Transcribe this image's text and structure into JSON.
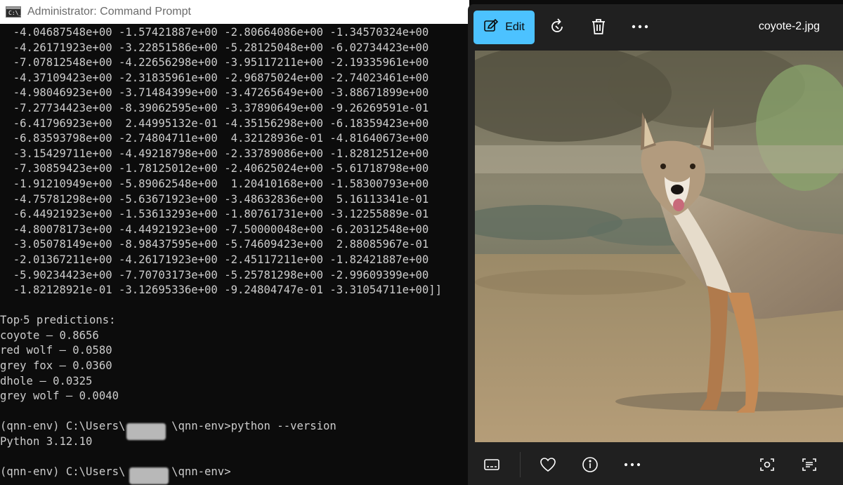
{
  "cmd": {
    "title": "Administrator: Command Prompt",
    "icon_text": "C:\\_",
    "lines": [
      "  -4.04687548e+00 -1.57421887e+00 -2.80664086e+00 -1.34570324e+00",
      "  -4.26171923e+00 -3.22851586e+00 -5.28125048e+00 -6.02734423e+00",
      "  -7.07812548e+00 -4.22656298e+00 -3.95117211e+00 -2.19335961e+00",
      "  -4.37109423e+00 -2.31835961e+00 -2.96875024e+00 -2.74023461e+00",
      "  -4.98046923e+00 -3.71484399e+00 -3.47265649e+00 -3.88671899e+00",
      "  -7.27734423e+00 -8.39062595e+00 -3.37890649e+00 -9.26269591e-01",
      "  -6.41796923e+00  2.44995132e-01 -4.35156298e+00 -6.18359423e+00",
      "  -6.83593798e+00 -2.74804711e+00  4.32128936e-01 -4.81640673e+00",
      "  -3.15429711e+00 -4.49218798e+00 -2.33789086e+00 -1.82812512e+00",
      "  -7.30859423e+00 -1.78125012e+00 -2.40625024e+00 -5.61718798e+00",
      "  -1.91210949e+00 -5.89062548e+00  1.20410168e+00 -1.58300793e+00",
      "  -4.75781298e+00 -5.63671923e+00 -3.48632836e+00  5.16113341e-01",
      "  -6.44921923e+00 -1.53613293e+00 -1.80761731e+00 -3.12255889e-01",
      "  -4.80078173e+00 -4.44921923e+00 -7.50000048e+00 -6.20312548e+00",
      "  -3.05078149e+00 -8.98437595e+00 -5.74609423e+00  2.88085967e-01",
      "  -2.01367211e+00 -4.26171923e+00 -2.45117211e+00 -1.82421887e+00",
      "  -5.90234423e+00 -7.70703173e+00 -5.25781298e+00 -2.99609399e+00",
      "  -1.82128921e-01 -3.12695336e+00 -9.24804747e-01 -3.31054711e+00]]",
      "",
      "Top‧5 predictions:",
      "coyote — 0.8656",
      "red wolf — 0.0580",
      "grey fox — 0.0360",
      "dhole — 0.0325",
      "grey wolf — 0.0040",
      "",
      "(qnn-env) C:\\Users\\       \\qnn-env>python --version",
      "Python 3.12.10",
      "",
      "(qnn-env) C:\\Users\\       \\qnn-env>"
    ]
  },
  "photos": {
    "edit_label": "Edit",
    "filename": "coyote-2.jpg",
    "toolbar_icons": [
      "edit-icon",
      "rotate-icon",
      "delete-icon",
      "more-icon"
    ],
    "bottom_icons": [
      "filmstrip-icon",
      "heart-icon",
      "info-icon",
      "more-icon",
      "visual-search-icon",
      "text-recognition-icon"
    ],
    "accent_color": "#4cc2ff"
  }
}
